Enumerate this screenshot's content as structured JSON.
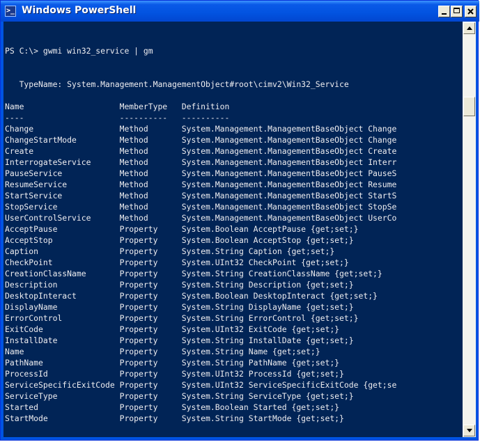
{
  "window": {
    "title": "Windows PowerShell",
    "icon": "powershell-icon",
    "icon_glyph": ">_",
    "controls": [
      "minimize-icon",
      "maximize-icon",
      "close-icon"
    ]
  },
  "console": {
    "prompt": "PS C:\\> gwmi win32_service | gm",
    "typename_line": "   TypeName: System.Management.ManagementObject#root\\cimv2\\Win32_Service",
    "header": "Name                    MemberType   Definition",
    "underline": "----                    ----------   ----------",
    "rows": [
      "Change                  Method       System.Management.ManagementBaseObject Change",
      "ChangeStartMode         Method       System.Management.ManagementBaseObject Change",
      "Create                  Method       System.Management.ManagementBaseObject Create",
      "InterrogateService      Method       System.Management.ManagementBaseObject Interr",
      "PauseService            Method       System.Management.ManagementBaseObject PauseS",
      "ResumeService           Method       System.Management.ManagementBaseObject Resume",
      "StartService            Method       System.Management.ManagementBaseObject StartS",
      "StopService             Method       System.Management.ManagementBaseObject StopSe",
      "UserControlService      Method       System.Management.ManagementBaseObject UserCo",
      "AcceptPause             Property     System.Boolean AcceptPause {get;set;}",
      "AcceptStop              Property     System.Boolean AcceptStop {get;set;}",
      "Caption                 Property     System.String Caption {get;set;}",
      "CheckPoint              Property     System.UInt32 CheckPoint {get;set;}",
      "CreationClassName       Property     System.String CreationClassName {get;set;}",
      "Description             Property     System.String Description {get;set;}",
      "DesktopInteract         Property     System.Boolean DesktopInteract {get;set;}",
      "DisplayName             Property     System.String DisplayName {get;set;}",
      "ErrorControl            Property     System.String ErrorControl {get;set;}",
      "ExitCode                Property     System.UInt32 ExitCode {get;set;}",
      "InstallDate             Property     System.String InstallDate {get;set;}",
      "Name                    Property     System.String Name {get;set;}",
      "PathName                Property     System.String PathName {get;set;}",
      "ProcessId               Property     System.UInt32 ProcessId {get;set;}",
      "ServiceSpecificExitCode Property     System.UInt32 ServiceSpecificExitCode {get;se",
      "ServiceType             Property     System.String ServiceType {get;set;}",
      "Started                 Property     System.Boolean Started {get;set;}",
      "StartMode               Property     System.String StartMode {get;set;}"
    ]
  },
  "colors": {
    "console_bg": "#012456",
    "console_fg": "#eeedf0",
    "titlebar": "#0054e3"
  }
}
